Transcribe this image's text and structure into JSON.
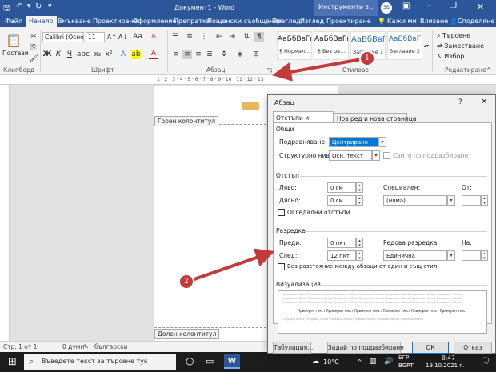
{
  "title_bar": {
    "doc_title": "Документ1 - Word",
    "context_group": "Инструменти з...",
    "user_initials": "ЗБ"
  },
  "tabs": [
    "Файл",
    "Начало",
    "Вмъкване",
    "Проектиране",
    "Оформление",
    "Препратки",
    "Пощенски съобщения",
    "Преглед",
    "Изглед",
    "Проектиране",
    "Кажи ми",
    "Влизане",
    "Споделяне"
  ],
  "ribbon": {
    "clipboard_group": "Клипборд",
    "paste": "Постави",
    "font_group": "Шрифт",
    "font_name": "Calibri (Основ",
    "font_size": "11",
    "paragraph_group": "Абзац",
    "styles_group": "Стилове",
    "styles": [
      {
        "sample": "АаБбВвГг,",
        "name": "¶ Нормал..."
      },
      {
        "sample": "АаБбВвГг,",
        "name": "¶ Без ра..."
      },
      {
        "sample": "АаБбВвГ",
        "name": "Заглавие 1"
      },
      {
        "sample": "АаБбВвГ",
        "name": "Заглавие 2"
      }
    ],
    "editing_group": "Редактиране",
    "find": "Търсене",
    "replace": "Заместване",
    "select": "Избор"
  },
  "ruler_ticks": "1 · 2 · 3 · 4 · 5 · 6 · 7 · 8 · 9 · 10 · 11 · 12 · 13",
  "document": {
    "header_tag": "Горен колонтитул",
    "footer_tag": "Долен колонтитул"
  },
  "dialog": {
    "title": "Абзац",
    "help": "?",
    "tabs": [
      "Отстъпи и разредка",
      "Нов ред и нова страница"
    ],
    "general": {
      "section": "Общи",
      "alignment_label": "Подравняване:",
      "alignment_value": "Центрирано",
      "outline_label": "Структурно ниво:",
      "outline_value": "Осн. текст",
      "collapsed_label": "Свито по подразбиране"
    },
    "indent": {
      "section": "Отстъп",
      "left_label": "Ляво:",
      "left_value": "0 см",
      "right_label": "Дясно:",
      "right_value": "0 см",
      "special_label": "Специален:",
      "special_value": "(няма)",
      "by_label": "От:",
      "mirror_label": "Огледални отстъпи"
    },
    "spacing": {
      "section": "Разредка",
      "before_label": "Преди:",
      "before_value": "0 пкт",
      "after_label": "След:",
      "after_value": "12 пкт",
      "line_label": "Редова разредка:",
      "line_value": "Единична",
      "at_label": "На:",
      "no_space_label": "Без разстояние между абзаци от един и същ стил"
    },
    "preview": {
      "section": "Визуализация",
      "prev_line": "Предишен абзац Предишен абзац Предишен абзац Предишен абзац Предишен абзац Предишен абзац Предишен абзац",
      "sample_line": "Примерен текст Примерен текст Примерен текст Примерен текст Примерен текст Примерен текст",
      "next_line": "Следващ абзац Следващ абзац Следващ абзац Следващ абзац Следващ абзац Следващ абзац"
    },
    "buttons": {
      "tabs": "Табулация...",
      "default": "Задай по подразбиране",
      "ok": "ОК",
      "cancel": "Отказ"
    }
  },
  "callouts": [
    "1",
    "2"
  ],
  "status": {
    "page": "Стр. 1 от 1",
    "words": "0 думи",
    "language": "български"
  },
  "taskbar": {
    "search_placeholder": "Въведете текст за търсене тук",
    "weather": "10°C",
    "lang": "БГР",
    "lang2": "BGPT",
    "time": "8:47",
    "date": "19.10.2021 г."
  },
  "colors": {
    "word_blue": "#2b579a",
    "callout_red": "#c23a3a",
    "highlight": "#0078d7"
  }
}
